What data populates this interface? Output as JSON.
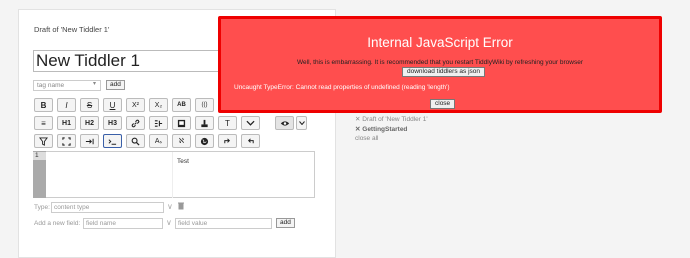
{
  "editor": {
    "draft_title": "Draft of 'New Tiddler 1'",
    "title_value": "New Tiddler 1",
    "tag_placeholder": "tag name",
    "add_tag_label": "add",
    "toolbar_row1": [
      "B",
      "I",
      "S",
      "U",
      "X²",
      "X₂",
      "AB",
      "(()"
    ],
    "toolbar_row2": [
      "≡",
      "H1",
      "H2",
      "H3",
      "link",
      "transclude",
      "image",
      "stamp",
      "T",
      "▾",
      "preview",
      "▾"
    ],
    "toolbar_row3": [
      "filter",
      "fullscreen",
      "indent",
      "command",
      "zoom",
      "A",
      "translate",
      "globe",
      "redo",
      "undo"
    ],
    "line_number": "1",
    "preview_text": "Test",
    "type_label": "Type:",
    "type_placeholder": "content type",
    "new_field_label": "Add a new field:",
    "field_name_placeholder": "field name",
    "field_value_placeholder": "field value",
    "add_field_label": "add"
  },
  "story_list": {
    "items": [
      "Draft of 'New Tiddler 1'",
      "GettingStarted"
    ],
    "close_all": "close all"
  },
  "error": {
    "title": "Internal JavaScript Error",
    "message": "Well, this is embarrassing. It is recommended that you restart TiddlyWiki by refreshing your browser",
    "download_label": "download tiddlers as json",
    "detail": "Uncaught TypeError: Cannot read properties of undefined (reading 'length')",
    "close_label": "close",
    "bg_color": "#ff4e4e",
    "border_color": "#ee0000"
  }
}
